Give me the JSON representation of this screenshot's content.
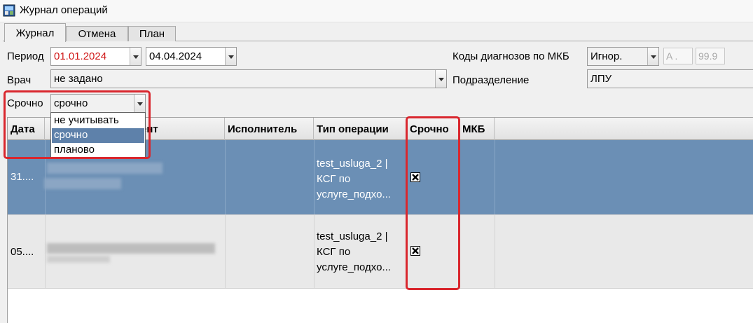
{
  "window": {
    "title": "Журнал операций",
    "app_icon": "app-window-icon"
  },
  "tabs": [
    {
      "label": "Журнал",
      "active": true
    },
    {
      "label": "Отмена",
      "active": false
    },
    {
      "label": "План",
      "active": false
    }
  ],
  "filters": {
    "period_label": "Период",
    "date_from": "01.01.2024",
    "date_to": "04.04.2024",
    "mkb_label": "Коды диагнозов по МКБ",
    "mkb_mode": "Игнор.",
    "mkb_from": "A  .",
    "mkb_to": "99.9",
    "doctor_label": "Врач",
    "doctor_value": "не задано",
    "department_label": "Подразделение",
    "department_value": "ЛПУ",
    "urgent_label": "Срочно",
    "urgent_value": "срочно",
    "urgent_options": [
      {
        "label": "не учитывать",
        "selected": false
      },
      {
        "label": "срочно",
        "selected": true
      },
      {
        "label": "планово",
        "selected": false
      }
    ]
  },
  "grid": {
    "columns": [
      "Дата",
      "ент",
      "Исполнитель",
      "Тип операции",
      "Срочно",
      "МКБ"
    ],
    "rows": [
      {
        "date": "31....",
        "patient_blurred": true,
        "executor": "",
        "op_type": [
          "test_usluga_2 |",
          "КСГ по",
          "услуге_подхо..."
        ],
        "urgent": true,
        "mkb": "",
        "selected": true
      },
      {
        "date": "05....",
        "patient_blurred": true,
        "executor": "",
        "op_type": [
          "test_usluga_2 |",
          "КСГ по",
          "услуге_подхо..."
        ],
        "urgent": true,
        "mkb": "",
        "selected": false
      }
    ]
  },
  "colors": {
    "selected_row": "#6b8fb5",
    "highlight": "#d9272e",
    "date_from_text": "#d01818"
  }
}
